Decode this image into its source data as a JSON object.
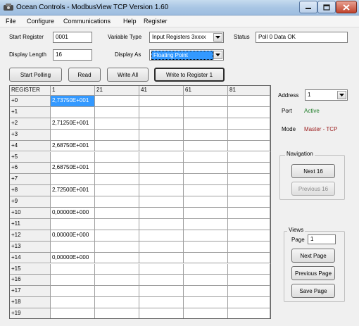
{
  "window": {
    "title": "Ocean Controls - ModbusView TCP Version 1.60"
  },
  "menu": [
    "File",
    "Configure",
    "Communications",
    "Help",
    "Register"
  ],
  "form": {
    "start_register_label": "Start Register",
    "start_register_value": "0001",
    "display_length_label": "Display Length",
    "display_length_value": "16",
    "variable_type_label": "Variable Type",
    "variable_type_value": "Input Registers 3xxxx",
    "display_as_label": "Display As",
    "display_as_value": "Floating Point",
    "status_label": "Status",
    "status_value": "Poll 0 Data OK"
  },
  "buttons": {
    "start_polling": "Start Polling",
    "read": "Read",
    "write_all": "Write All",
    "write_to_register": "Write to Register 1"
  },
  "grid": {
    "columns": [
      "REGISTER",
      "1",
      "21",
      "41",
      "61",
      "81"
    ],
    "row_labels": [
      "+0",
      "+1",
      "+2",
      "+3",
      "+4",
      "+5",
      "+6",
      "+7",
      "+8",
      "+9",
      "+10",
      "+11",
      "+12",
      "+13",
      "+14",
      "+15",
      "+16",
      "+17",
      "+18",
      "+19"
    ],
    "col1_values": [
      "2,73750E+001",
      "",
      "2,71250E+001",
      "",
      "2,68750E+001",
      "",
      "2,68750E+001",
      "",
      "2,72500E+001",
      "",
      "0,00000E+000",
      "",
      "0,00000E+000",
      "",
      "0,00000E+000",
      "",
      "",
      "",
      "",
      ""
    ]
  },
  "side": {
    "address_label": "Address",
    "address_value": "1",
    "port_label": "Port",
    "port_value": "Active",
    "mode_label": "Mode",
    "mode_value": "Master - TCP",
    "navigation_title": "Navigation",
    "next16": "Next 16",
    "previous16": "Previous 16",
    "views_title": "Views",
    "page_label": "Page",
    "page_value": "1",
    "next_page": "Next Page",
    "previous_page": "Previous Page",
    "save_page": "Save Page"
  },
  "colors": {
    "selection": "#3399ff",
    "port_active": "#207e2a",
    "mode_text": "#9b1c1c"
  }
}
